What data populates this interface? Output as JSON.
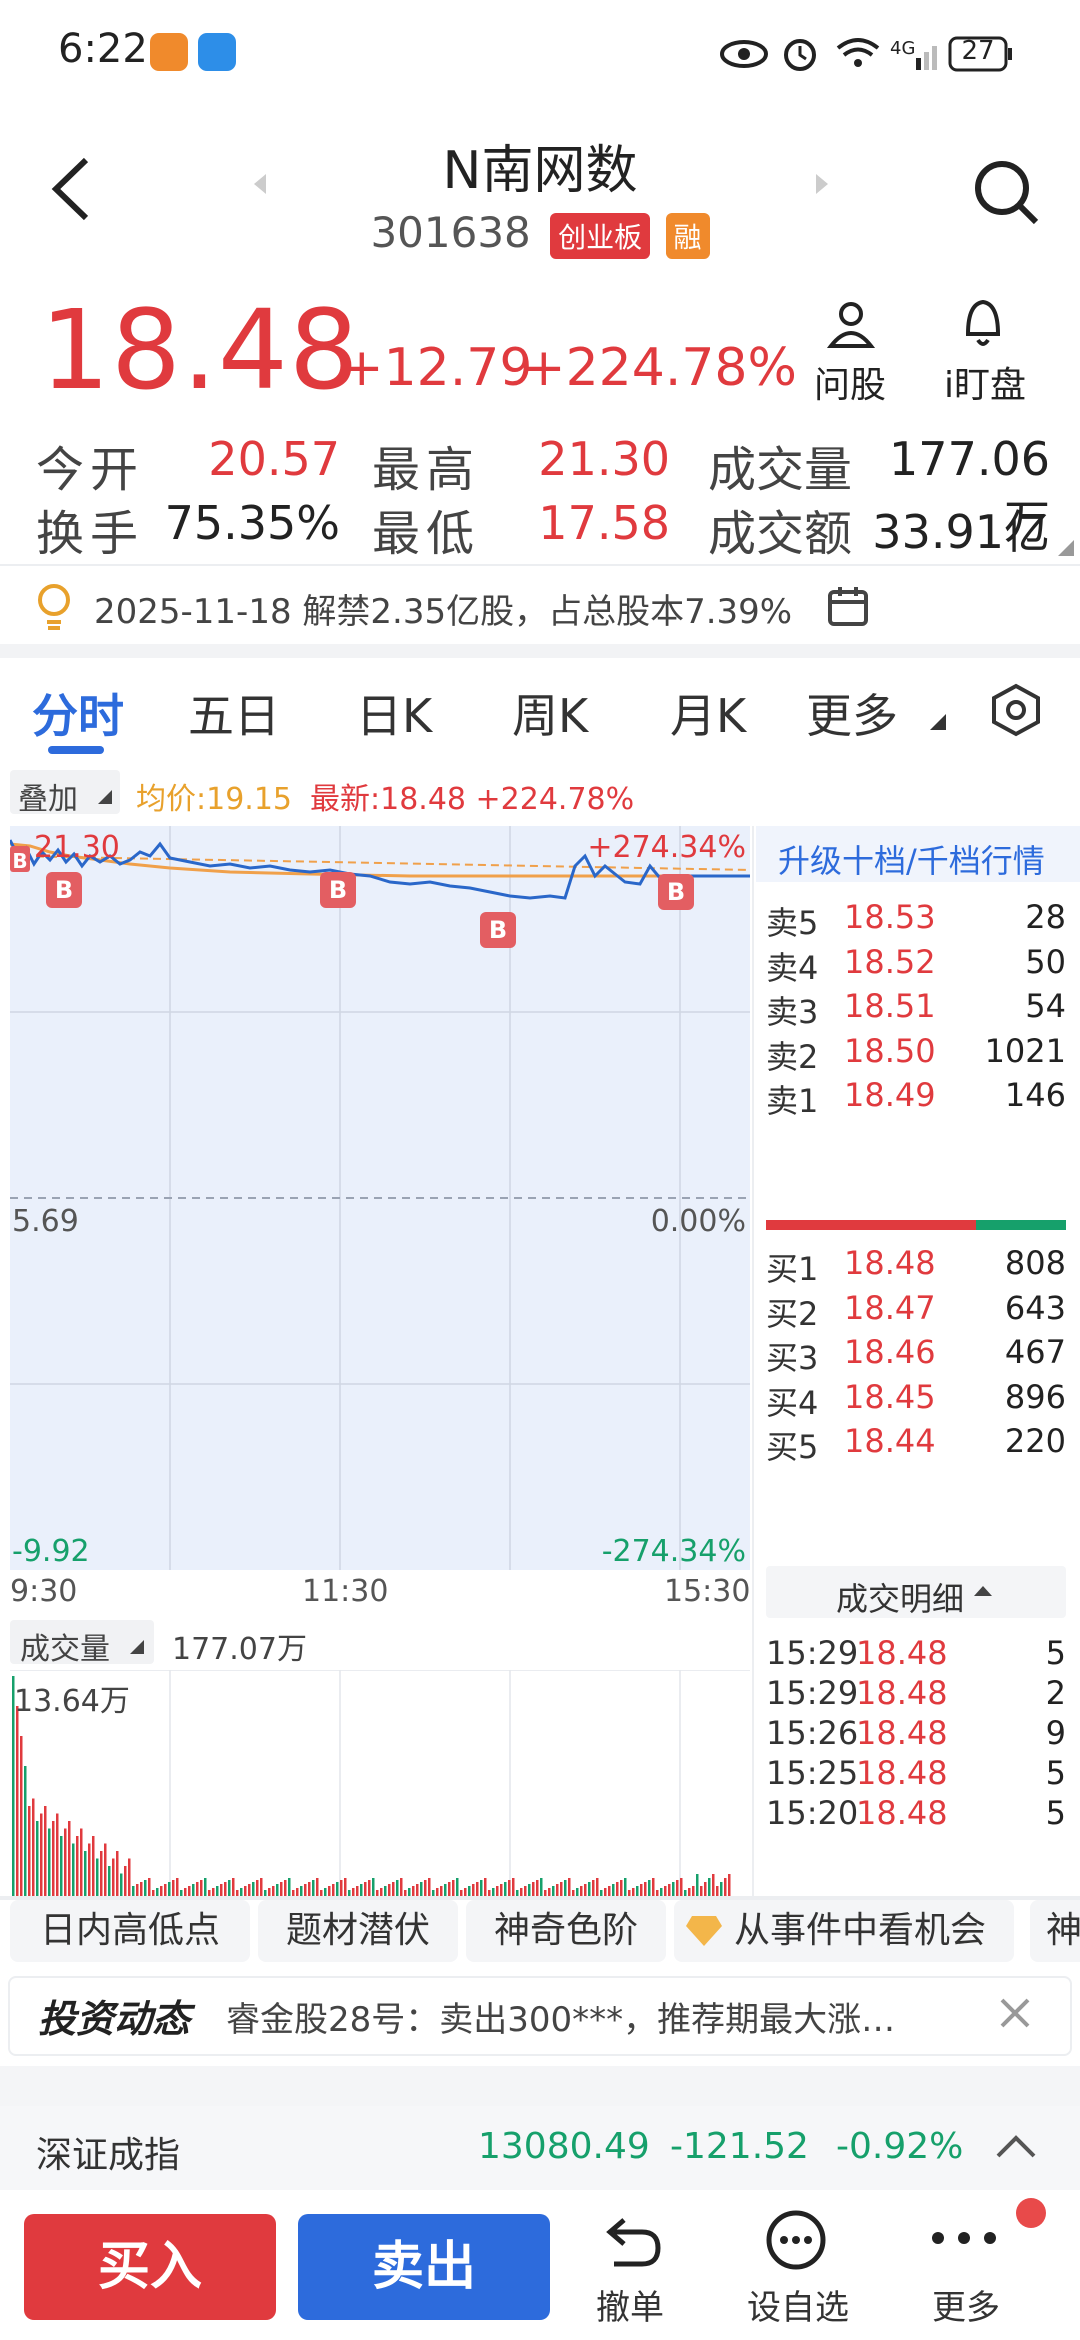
{
  "status_bar": {
    "time": "6:22",
    "battery": "27"
  },
  "header": {
    "title": "N南网数",
    "code": "301638",
    "board_tag": "创业板",
    "margin_tag": "融"
  },
  "quote": {
    "price": "18.48",
    "change": "+12.79",
    "change_pct": "+224.78%",
    "ask_label": "问股",
    "watch_label": "i盯盘"
  },
  "stats": [
    {
      "label": "今开",
      "value": "20.57",
      "color": "red"
    },
    {
      "label": "最高",
      "value": "21.30",
      "color": "red"
    },
    {
      "label": "成交量",
      "value": "177.06万",
      "color": "dark"
    },
    {
      "label": "换手",
      "value": "75.35%",
      "color": "dark"
    },
    {
      "label": "最低",
      "value": "17.58",
      "color": "red"
    },
    {
      "label": "成交额",
      "value": "33.91亿",
      "color": "dark"
    }
  ],
  "notice": "2025-11-18 解禁2.35亿股，占总股本7.39%",
  "tabs": [
    "分时",
    "五日",
    "日K",
    "周K",
    "月K",
    "更多"
  ],
  "chart_header": {
    "overlay": "叠加",
    "avg_price": "均价:19.15",
    "latest": "最新:18.48 +224.78%"
  },
  "chart_labels": {
    "top_left": "21.30",
    "top_right": "+274.34%",
    "mid_left": "5.69",
    "mid_right": "0.00%",
    "bottom_left": "-9.92",
    "bottom_right": "-274.34%",
    "time_start": "9:30",
    "time_mid": "11:30",
    "time_end": "15:30",
    "buy_marker": "B"
  },
  "volume": {
    "label": "成交量",
    "value": "177.07万",
    "peak": "13.64万"
  },
  "orderbook": {
    "upgrade_label": "升级十档/千档行情",
    "asks": [
      {
        "label": "卖5",
        "price": "18.53",
        "qty": "28"
      },
      {
        "label": "卖4",
        "price": "18.52",
        "qty": "50"
      },
      {
        "label": "卖3",
        "price": "18.51",
        "qty": "54"
      },
      {
        "label": "卖2",
        "price": "18.50",
        "qty": "1021"
      },
      {
        "label": "卖1",
        "price": "18.49",
        "qty": "146"
      }
    ],
    "bids": [
      {
        "label": "买1",
        "price": "18.48",
        "qty": "808"
      },
      {
        "label": "买2",
        "price": "18.47",
        "qty": "643"
      },
      {
        "label": "买3",
        "price": "18.46",
        "qty": "467"
      },
      {
        "label": "买4",
        "price": "18.45",
        "qty": "896"
      },
      {
        "label": "买5",
        "price": "18.44",
        "qty": "220"
      }
    ],
    "detail_label": "成交明细",
    "trades": [
      {
        "time": "15:29",
        "price": "18.48",
        "qty": "5"
      },
      {
        "time": "15:29",
        "price": "18.48",
        "qty": "2"
      },
      {
        "time": "15:26",
        "price": "18.48",
        "qty": "9"
      },
      {
        "time": "15:25",
        "price": "18.48",
        "qty": "5"
      },
      {
        "time": "15:20",
        "price": "18.48",
        "qty": "5"
      }
    ]
  },
  "chips": [
    "日内高低点",
    "题材潜伏",
    "神奇色阶",
    "从事件中看机会",
    "神"
  ],
  "news": {
    "logo": "投资动态",
    "text": "睿金股28号：卖出300***，推荐期最大涨…"
  },
  "index_bar": {
    "name": "深证成指",
    "value": "13080.49",
    "change": "-121.52",
    "pct": "-0.92%"
  },
  "actions": {
    "buy": "买入",
    "sell": "卖出",
    "cancel": "撤单",
    "watchlist": "设自选",
    "more": "更多"
  },
  "colors": {
    "up": "#e03a3e",
    "down": "#16a06b",
    "accent": "#2d6bdc",
    "avg": "#e8a12c"
  }
}
